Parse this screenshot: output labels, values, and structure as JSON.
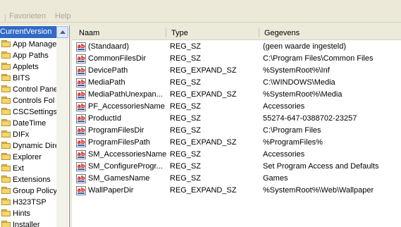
{
  "menu": {
    "cut_label": "l",
    "favorites_label": "Favorieten",
    "help_label": "Help"
  },
  "tree": {
    "selected": "CurrentVersion",
    "items": [
      "App Manage",
      "App Paths",
      "Applets",
      "BITS",
      "Control Pane",
      "Controls Fol",
      "CSCSettings",
      "DateTime",
      "DIFx",
      "Dynamic Dire",
      "Explorer",
      "Ext",
      "Extensions",
      "Group Policy",
      "H323TSP",
      "Hints",
      "Installer"
    ]
  },
  "list": {
    "columns": [
      "Naam",
      "Type",
      "Gegevens"
    ],
    "rows": [
      {
        "name": "(Standaard)",
        "type": "REG_SZ",
        "data": "(geen waarde ingesteld)"
      },
      {
        "name": "CommonFilesDir",
        "type": "REG_SZ",
        "data": "C:\\Program Files\\Common Files"
      },
      {
        "name": "DevicePath",
        "type": "REG_EXPAND_SZ",
        "data": "%SystemRoot%\\Inf"
      },
      {
        "name": "MediaPath",
        "type": "REG_SZ",
        "data": "C:\\WINDOWS\\Media"
      },
      {
        "name": "MediaPathUnexpan...",
        "type": "REG_EXPAND_SZ",
        "data": "%SystemRoot%\\Media"
      },
      {
        "name": "PF_AccessoriesName",
        "type": "REG_SZ",
        "data": "Accessories"
      },
      {
        "name": "ProductId",
        "type": "REG_SZ",
        "data": "55274-647-0388702-23257"
      },
      {
        "name": "ProgramFilesDir",
        "type": "REG_SZ",
        "data": "C:\\Program Files"
      },
      {
        "name": "ProgramFilesPath",
        "type": "REG_EXPAND_SZ",
        "data": "%ProgramFiles%"
      },
      {
        "name": "SM_AccessoriesName",
        "type": "REG_SZ",
        "data": "Accessories"
      },
      {
        "name": "SM_ConfigureProgr...",
        "type": "REG_SZ",
        "data": "Set Program Access and Defaults"
      },
      {
        "name": "SM_GamesName",
        "type": "REG_SZ",
        "data": "Games"
      },
      {
        "name": "WallPaperDir",
        "type": "REG_EXPAND_SZ",
        "data": "%SystemRoot%\\Web\\Wallpaper"
      }
    ]
  },
  "icons": {
    "value_icon": "ab-string-value-icon",
    "folder_icon": "folder-icon",
    "scroll_up": "scroll-up-arrow-icon"
  },
  "colors": {
    "selection": "#316ac5",
    "folder": "#f5d66b",
    "value_icon_text": "#c00000"
  }
}
